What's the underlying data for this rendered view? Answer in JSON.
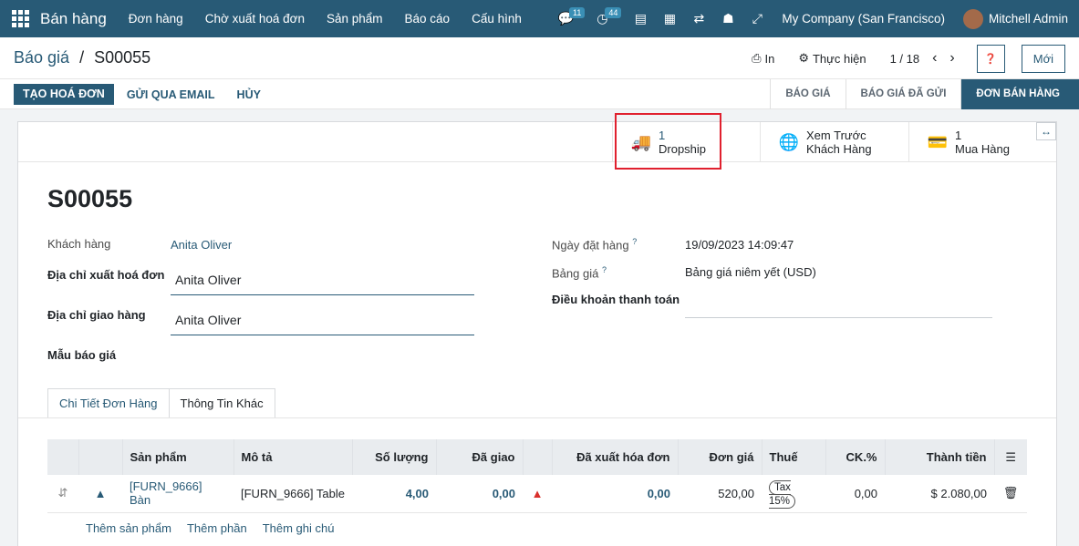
{
  "navbar": {
    "app_name": "Bán hàng",
    "menu": [
      "Đơn hàng",
      "Chờ xuất hoá đơn",
      "Sản phẩm",
      "Báo cáo",
      "Cấu hình"
    ],
    "messages_count": "11",
    "activities_count": "44",
    "company": "My Company (San Francisco)",
    "user": "Mitchell Admin"
  },
  "control_panel": {
    "breadcrumb_parent": "Báo giá",
    "breadcrumb_sep": "/",
    "breadcrumb_current": "S00055",
    "print_label": "In",
    "action_label": "Thực hiện",
    "pager": "1 / 18",
    "new_label": "Mới"
  },
  "statusbar": {
    "create_invoice": "TẠO HOÁ ĐƠN",
    "send_email": "GỬI QUA EMAIL",
    "cancel": "HỦY",
    "stages": [
      "BÁO GIÁ",
      "BÁO GIÁ ĐÃ GỬI",
      "ĐƠN BÁN HÀNG"
    ],
    "active_stage": "ĐƠN BÁN HÀNG"
  },
  "smart_buttons": {
    "dropship_count": "1",
    "dropship_label": "Dropship",
    "preview_line1": "Xem Trước",
    "preview_line2": "Khách Hàng",
    "purchase_count": "1",
    "purchase_label": "Mua Hàng"
  },
  "form": {
    "name": "S00055",
    "customer_label": "Khách hàng",
    "customer_value": "Anita Oliver",
    "invoice_address_label": "Địa chỉ xuất hoá đơn",
    "invoice_address_value": "Anita Oliver",
    "delivery_address_label": "Địa chỉ giao hàng",
    "delivery_address_value": "Anita Oliver",
    "quotation_template_label": "Mẫu báo giá",
    "order_date_label": "Ngày đặt hàng",
    "order_date_value": "19/09/2023 14:09:47",
    "pricelist_label": "Bảng giá",
    "pricelist_value": "Bảng giá niêm yết (USD)",
    "payment_terms_label": "Điều khoản thanh toán",
    "help_mark": "?"
  },
  "tabs": [
    "Chi Tiết Đơn Hàng",
    "Thông Tin Khác"
  ],
  "order_lines": {
    "headers": [
      "Sản phẩm",
      "Mô tả",
      "Số lượng",
      "Đã giao",
      "Đã xuất hóa đơn",
      "Đơn giá",
      "Thuế",
      "CK.%",
      "Thành tiền"
    ],
    "rows": [
      {
        "product": "[FURN_9666] Bàn",
        "description": "[FURN_9666] Table",
        "quantity": "4,00",
        "delivered": "0,00",
        "invoiced": "0,00",
        "unit_price": "520,00",
        "tax": "Tax 15%",
        "discount": "0,00",
        "subtotal": "$ 2.080,00"
      }
    ],
    "add_product": "Thêm sản phẩm",
    "add_section": "Thêm phần",
    "add_note": "Thêm ghi chú"
  },
  "colors": {
    "navbar": "#285a76",
    "highlight": "#e0202e"
  }
}
